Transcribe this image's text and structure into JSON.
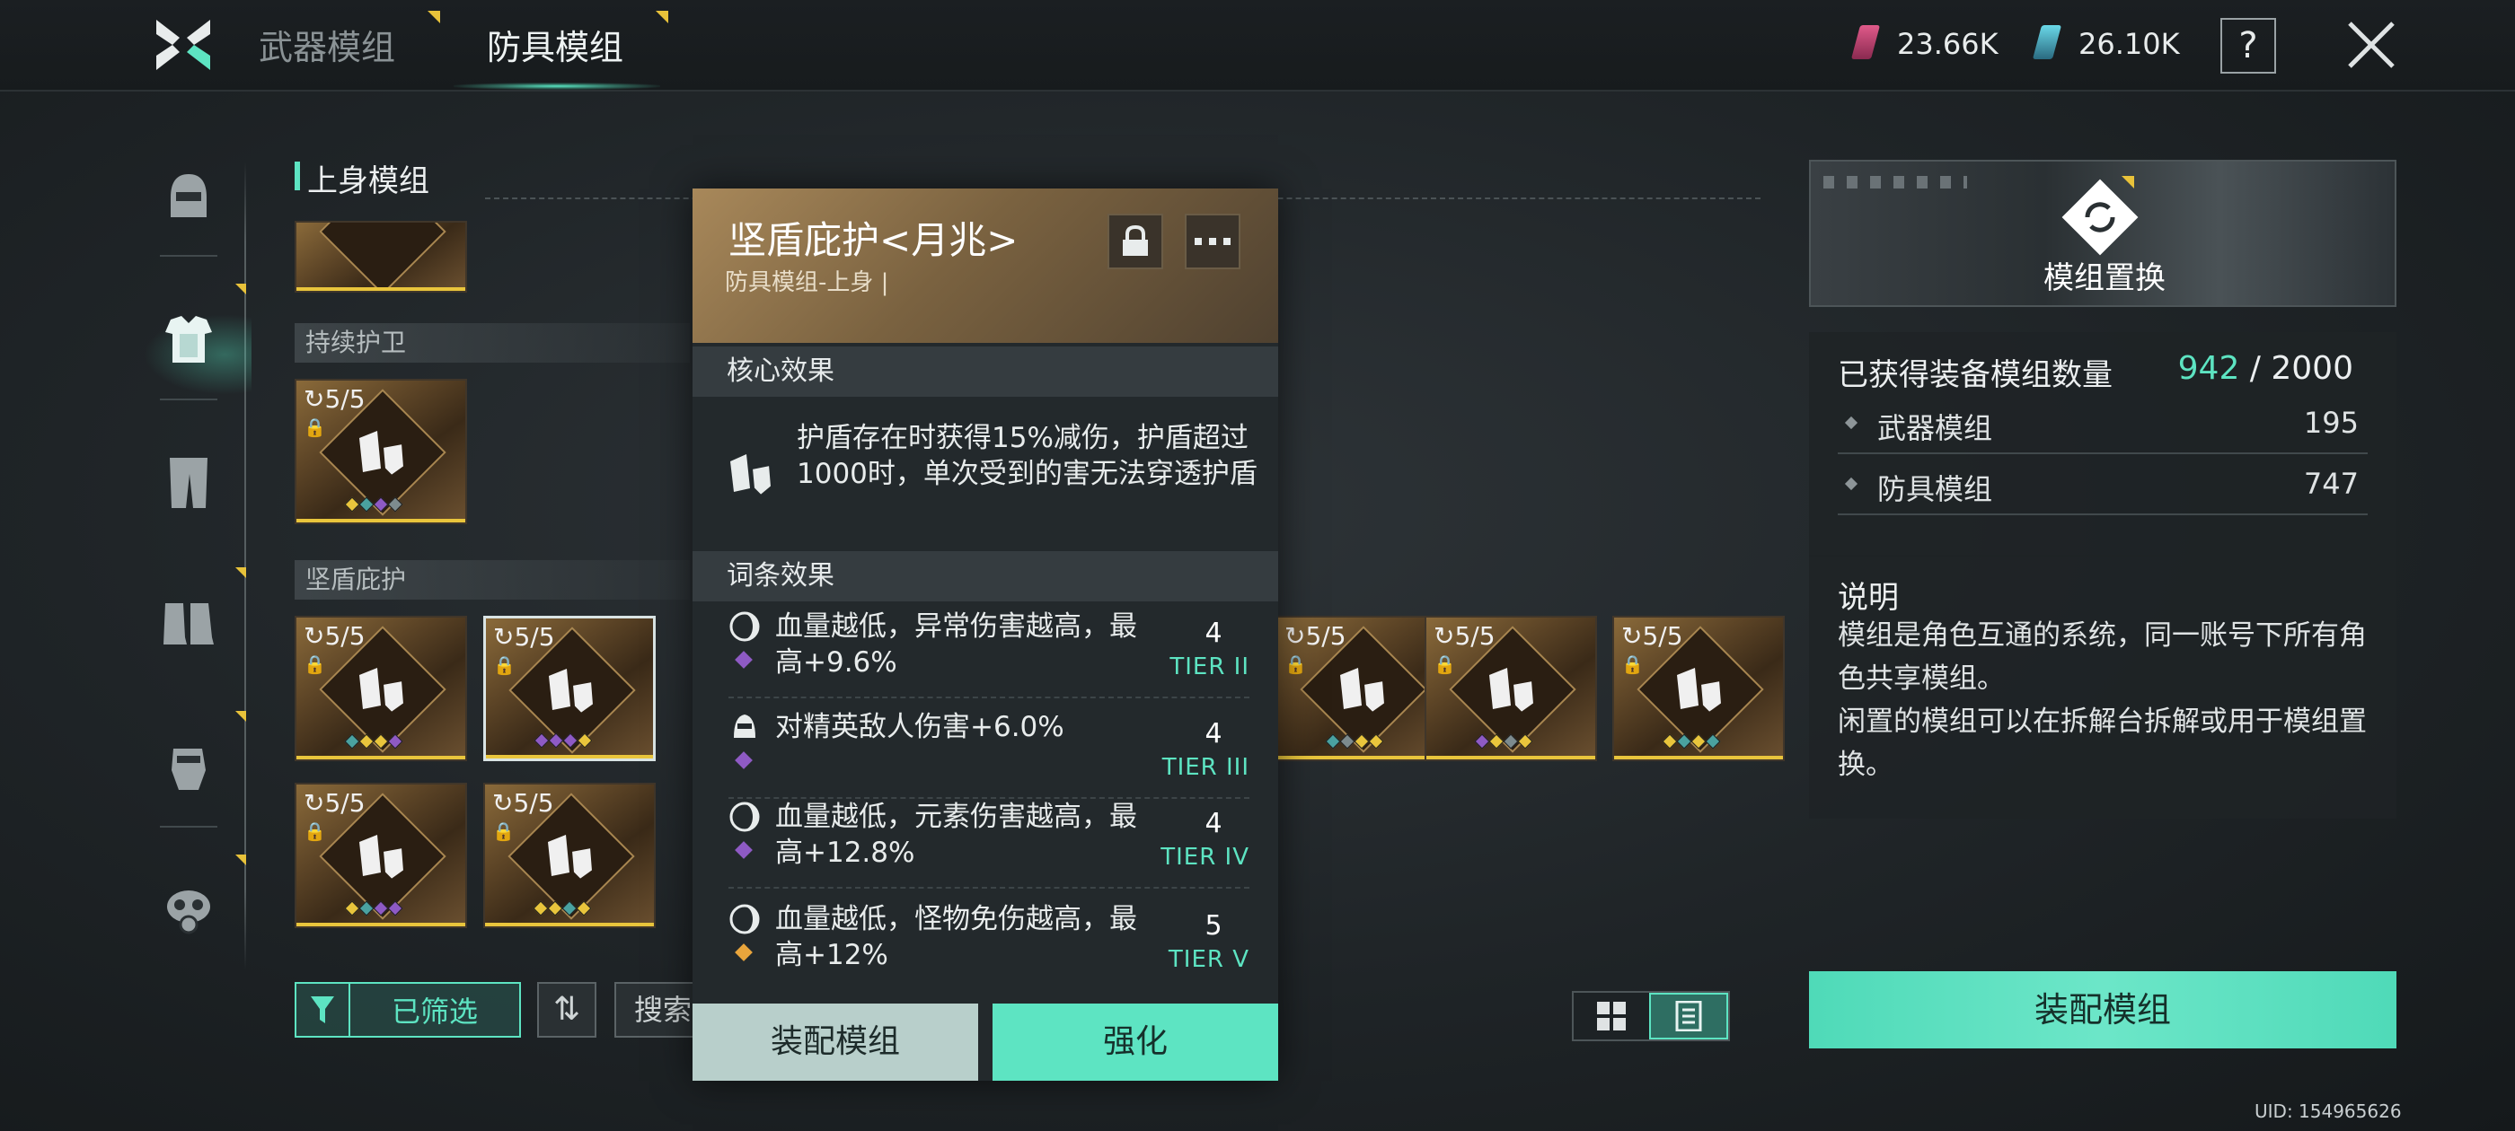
{
  "tabs": {
    "weapon": "武器模组",
    "armor": "防具模组"
  },
  "currency": {
    "pink": "23.66K",
    "teal": "26.10K"
  },
  "help_label": "?",
  "nav_icons": [
    "helmet-icon",
    "chest-armor-icon",
    "legs-armor-icon",
    "boots-icon",
    "gloves-icon",
    "gas-mask-icon"
  ],
  "section_title": "上身模组",
  "groups": {
    "g1": "持续护卫",
    "g2": "坚盾庇护"
  },
  "cards": [
    {
      "count": "5/5",
      "dots": [
        "#e9c53c",
        "#4aa2a0",
        "#8e5ac4",
        "#7d8b8e"
      ]
    },
    {
      "count": "5/5",
      "dots": [
        "#4aa2a0",
        "#e9c53c",
        "#e9c53c",
        "#8e5ac4"
      ]
    },
    {
      "count": "5/5",
      "dots": [
        "#8e5ac4",
        "#8e5ac4",
        "#8e5ac4",
        "#e9c53c"
      ]
    },
    {
      "count": "5/5",
      "dots": [
        "#4aa2a0",
        "#7d8b8e",
        "#e9c53c",
        "#e9c53c"
      ]
    },
    {
      "count": "5/5",
      "dots": [
        "#8e5ac4",
        "#e9c53c",
        "#7d8b8e",
        "#e9c53c"
      ]
    },
    {
      "count": "5/5",
      "dots": [
        "#e9c53c",
        "#4aa2a0",
        "#e9c53c",
        "#4aa2a0"
      ]
    },
    {
      "count": "5/5",
      "dots": [
        "#e9c53c",
        "#4aa2a0",
        "#8e5ac4",
        "#8e5ac4"
      ]
    },
    {
      "count": "5/5",
      "dots": [
        "#e9c53c",
        "#e9c53c",
        "#4aa2a0",
        "#e9c53c"
      ]
    }
  ],
  "controls": {
    "filter": "已筛选",
    "search": "搜索"
  },
  "popup": {
    "title": "坚盾庇护<月兆>",
    "subtitle": "防具模组-上身 |",
    "core_heading": "核心效果",
    "core_text": "护盾存在时获得15%减伤，护盾超过1000时，单次受到的害无法穿透护盾",
    "affix_heading": "词条效果",
    "affixes": [
      {
        "text": "血量越低，异常伤害越高，最高+9.6%",
        "tier_num": "4",
        "tier": "TIER II",
        "dot": "#8e5ac4"
      },
      {
        "text": "对精英敌人伤害+6.0%",
        "tier_num": "4",
        "tier": "TIER III",
        "dot": "#8e5ac4"
      },
      {
        "text": "血量越低，元素伤害越高，最高+12.8%",
        "tier_num": "4",
        "tier": "TIER IV",
        "dot": "#8e5ac4"
      },
      {
        "text": "血量越低，怪物免伤越高，最高+12%",
        "tier_num": "5",
        "tier": "TIER V",
        "dot": "#e9a53c"
      }
    ],
    "btn_equip": "装配模组",
    "btn_enhance": "强化"
  },
  "swap_label": "模组置换",
  "stats": {
    "title": "已获得装备模组数量",
    "owned": "942",
    "sep": " / ",
    "max": "2000",
    "rows": [
      {
        "label": "武器模组",
        "value": "195"
      },
      {
        "label": "防具模组",
        "value": "747"
      }
    ]
  },
  "desc": {
    "title": "说明",
    "line1": "模组是角色互通的系统，同一账号下所有角色共享模组。",
    "line2": "闲置的模组可以在拆解台拆解或用于模组置换。"
  },
  "equip_label": "装配模组",
  "uid": "UID: 154965626"
}
